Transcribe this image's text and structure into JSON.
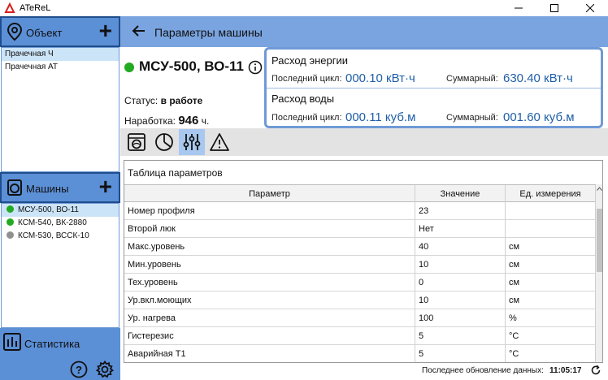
{
  "window": {
    "title": "ATeReL"
  },
  "sidebar": {
    "objects_header": "Объект",
    "objects": [
      {
        "label": "Прачечная Ч",
        "selected": true
      },
      {
        "label": "Прачечная АТ",
        "selected": false
      }
    ],
    "machines_header": "Машины",
    "machines": [
      {
        "label": "МСУ-500, ВО-11",
        "status_color": "#22aa22",
        "selected": true
      },
      {
        "label": "КСМ-540, ВК-2880",
        "status_color": "#22aa22",
        "selected": false
      },
      {
        "label": "КСМ-530, ВССК-10",
        "status_color": "#909090",
        "selected": false
      }
    ],
    "statistics_label": "Статистика"
  },
  "header": {
    "title": "Параметры машины"
  },
  "machine": {
    "name": "МСУ-500, ВО-11",
    "status_label": "Статус:",
    "status_value": "в работе",
    "hours_label": "Наработка:",
    "hours_value": "946",
    "hours_unit": "ч."
  },
  "energy": {
    "title": "Расход энергии",
    "last_label": "Последний цикл:",
    "last_value": "000.10 кВт·ч",
    "total_label": "Суммарный:",
    "total_value": "630.40 кВт·ч"
  },
  "water": {
    "title": "Расход воды",
    "last_label": "Последний цикл:",
    "last_value": "000.11 куб.м",
    "total_label": "Суммарный:",
    "total_value": "001.60 куб.м"
  },
  "tools": [
    {
      "icon": "washing-machine-icon",
      "active": false
    },
    {
      "icon": "pie-chart-icon",
      "active": false
    },
    {
      "icon": "sliders-icon",
      "active": true
    },
    {
      "icon": "warning-icon",
      "active": false
    }
  ],
  "table": {
    "title": "Таблица параметров",
    "headers": [
      "Параметр",
      "Значение",
      "Ед. измерения"
    ],
    "rows": [
      [
        "Номер профиля",
        "23",
        ""
      ],
      [
        "Второй люк",
        "Нет",
        ""
      ],
      [
        "Макс.уровень",
        "40",
        "см"
      ],
      [
        "Мин.уровень",
        "10",
        "см"
      ],
      [
        "Тех.уровень",
        "0",
        "см"
      ],
      [
        "Ур.вкл.моющих",
        "10",
        "см"
      ],
      [
        "Ур. нагрева",
        "100",
        "%"
      ],
      [
        "Гистерезис",
        "5",
        "°C"
      ],
      [
        "Аварийная Т1",
        "5",
        "°C"
      ]
    ]
  },
  "footer": {
    "last_update_label": "Последнее обновление данных:",
    "last_update_time": "11:05:17"
  },
  "colors": {
    "accent": "#5b8fd6",
    "header": "#7aa4e0",
    "value_blue": "#1f5fa8",
    "running": "#22aa22",
    "idle": "#909090"
  }
}
